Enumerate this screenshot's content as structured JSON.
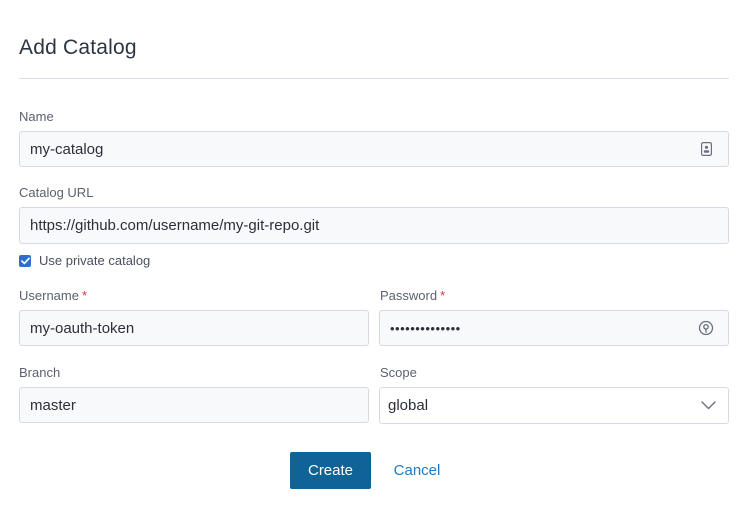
{
  "dialog": {
    "title": "Add Catalog"
  },
  "form": {
    "name": {
      "label": "Name",
      "value": "my-catalog"
    },
    "catalog_url": {
      "label": "Catalog URL",
      "value": "https://github.com/username/my-git-repo.git"
    },
    "private_catalog": {
      "label": "Use private catalog",
      "checked": true
    },
    "username": {
      "label": "Username",
      "required_mark": "*",
      "value": "my-oauth-token"
    },
    "password": {
      "label": "Password",
      "required_mark": "*",
      "value": "••••••••••••••"
    },
    "branch": {
      "label": "Branch",
      "value": "master"
    },
    "scope": {
      "label": "Scope",
      "value": "global"
    }
  },
  "actions": {
    "create_label": "Create",
    "cancel_label": "Cancel"
  },
  "colors": {
    "primary": "#0f6396",
    "link": "#1f79c3",
    "required": "#d0393e",
    "checkbox": "#2b6fd0"
  }
}
